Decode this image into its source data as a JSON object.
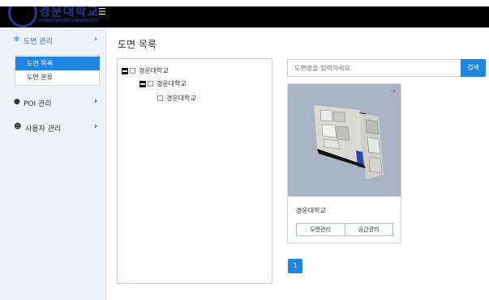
{
  "header": {
    "logo_name": "경운대학교",
    "logo_sub": "KYUNGWOON UNIVERSITY",
    "menu_icon": "hamburger-icon"
  },
  "sidebar": {
    "items": [
      {
        "icon": "map-pins-icon",
        "label": "도면 관리",
        "active": true
      },
      {
        "icon": "location-marker-icon",
        "label": "POI 관리",
        "active": false
      },
      {
        "icon": "users-icon",
        "label": "사용자 관리",
        "active": false
      }
    ],
    "submenu": [
      {
        "label": "도면 목록",
        "selected": true
      },
      {
        "label": "도면 분류",
        "selected": false
      }
    ],
    "chevron": "›"
  },
  "main": {
    "title": "도면 목록",
    "tree": [
      {
        "label": "경운대학교",
        "level": 0,
        "expander": true
      },
      {
        "label": "경운대학교",
        "level": 1,
        "expander": true
      },
      {
        "label": "경운대학교",
        "level": 2,
        "expander": false
      }
    ],
    "search": {
      "placeholder": "도면명을 입력하세요.",
      "button_label": "검색"
    },
    "card": {
      "title": "경운대학교",
      "close_glyph": "×",
      "buttons": [
        "도면관리",
        "공간관리"
      ]
    },
    "pagination": {
      "current_page": "1"
    }
  },
  "colors": {
    "accent": "#1e86e0",
    "topbar": "#000000",
    "sidebar_bg": "#eef1f6",
    "thumb_bg": "#a8b4c2"
  }
}
